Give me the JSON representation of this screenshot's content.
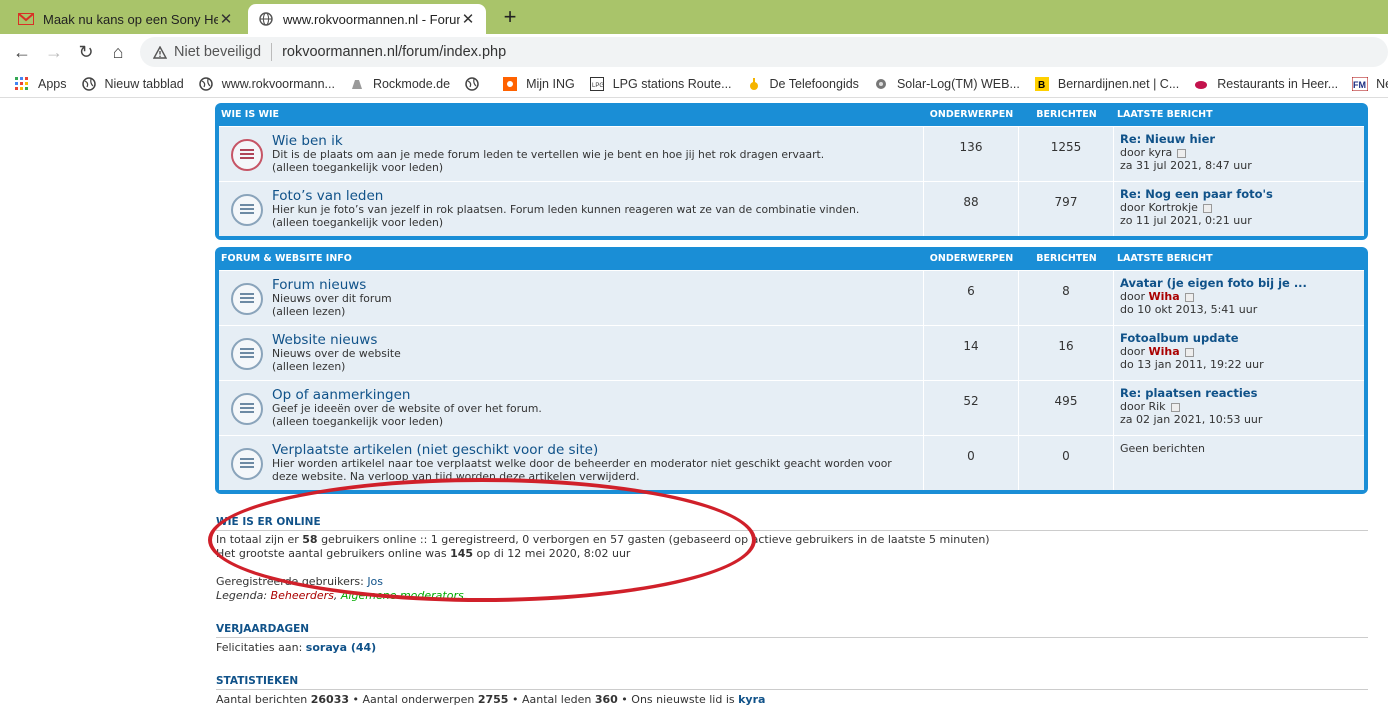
{
  "browser": {
    "tabs": [
      {
        "title": "Maak nu kans op een Sony Headp",
        "favicon": "gmail-icon",
        "active": false
      },
      {
        "title": "www.rokvoormannen.nl - Forum",
        "favicon": "globe-icon",
        "active": true
      }
    ],
    "security_label": "Niet beveiligd",
    "url": "rokvoormannen.nl/forum/index.php",
    "bookmarks": [
      {
        "label": "Apps",
        "icon": "apps-grid-icon"
      },
      {
        "label": "Nieuw tabblad",
        "icon": "globe-icon"
      },
      {
        "label": "www.rokvoormann...",
        "icon": "globe-icon"
      },
      {
        "label": "Rockmode.de",
        "icon": "rockmode-icon"
      },
      {
        "label": "",
        "icon": "globe-icon"
      },
      {
        "label": "Mijn ING",
        "icon": "ing-icon"
      },
      {
        "label": "LPG stations Route...",
        "icon": "lpg-icon"
      },
      {
        "label": "De Telefoongids",
        "icon": "telefoongids-icon"
      },
      {
        "label": "Solar-Log(TM) WEB...",
        "icon": "solarlog-icon"
      },
      {
        "label": "Bernardijnen.net | C...",
        "icon": "bernardijnen-icon"
      },
      {
        "label": "Restaurants in Heer...",
        "icon": "restaurants-icon"
      },
      {
        "label": "Nederlan",
        "icon": "fm-icon"
      }
    ]
  },
  "forum": {
    "col_topics": "ONDERWERPEN",
    "col_posts": "BERICHTEN",
    "col_last": "LAATSTE BERICHT",
    "categories": [
      {
        "name": "WIE IS WIE",
        "forums": [
          {
            "title": "Wie ben ik",
            "desc1": "Dit is de plaats om aan je mede forum leden te vertellen wie je bent en hoe jij het rok dragen ervaart.",
            "desc2": "(alleen toegankelijk voor leden)",
            "topics": "136",
            "posts": "1255",
            "last_title": "Re: Nieuw hier",
            "last_by": "door",
            "last_user": "kyra",
            "last_user_red": false,
            "last_date": "za 31 jul 2021, 8:47 uur",
            "unread": true
          },
          {
            "title": "Foto’s van leden",
            "desc1": "Hier kun je foto’s van jezelf in rok plaatsen. Forum leden kunnen reageren wat ze van de combinatie vinden.",
            "desc2": "(alleen toegankelijk voor leden)",
            "topics": "88",
            "posts": "797",
            "last_title": "Re: Nog een paar foto's",
            "last_by": "door",
            "last_user": "Kortrokje",
            "last_user_red": false,
            "last_date": "zo 11 jul 2021, 0:21 uur",
            "unread": false
          }
        ]
      },
      {
        "name": "FORUM & WEBSITE INFO",
        "forums": [
          {
            "title": "Forum nieuws",
            "desc1": "Nieuws over dit forum",
            "desc2": "(alleen lezen)",
            "topics": "6",
            "posts": "8",
            "last_title": "Avatar (je eigen foto bij je ...",
            "last_by": "door",
            "last_user": "Wiha",
            "last_user_red": true,
            "last_date": "do 10 okt 2013, 5:41 uur",
            "unread": false
          },
          {
            "title": "Website nieuws",
            "desc1": "Nieuws over de website",
            "desc2": "(alleen lezen)",
            "topics": "14",
            "posts": "16",
            "last_title": "Fotoalbum update",
            "last_by": "door",
            "last_user": "Wiha",
            "last_user_red": true,
            "last_date": "do 13 jan 2011, 19:22 uur",
            "unread": false
          },
          {
            "title": "Op of aanmerkingen",
            "desc1": "Geef je ideeën over de website of over het forum.",
            "desc2": "(alleen toegankelijk voor leden)",
            "topics": "52",
            "posts": "495",
            "last_title": "Re: plaatsen reacties",
            "last_by": "door",
            "last_user": "Rik",
            "last_user_red": false,
            "last_date": "za 02 jan 2021, 10:53 uur",
            "unread": false
          },
          {
            "title": "Verplaatste artikelen (niet geschikt voor de site)",
            "desc1": "Hier worden artikelel naar toe verplaatst welke door de beheerder en moderator niet geschikt geacht worden voor",
            "desc2": "deze website. Na verloop van tijd worden deze artikelen verwijderd.",
            "topics": "0",
            "posts": "0",
            "last_title": "",
            "last_by": "",
            "last_user": "",
            "last_user_red": false,
            "last_date": "",
            "no_posts": "Geen berichten",
            "unread": false
          }
        ]
      }
    ]
  },
  "online": {
    "heading": "WIE IS ER ONLINE",
    "line1_a": "In totaal zijn er",
    "total": "58",
    "line1_b": "gebruikers online :: 1 geregistreerd, 0 verborgen en 57 gasten (gebaseerd op actieve gebruikers in de laatste 5 minuten)",
    "line2_a": "Het grootste aantal gebruikers online was",
    "max": "145",
    "line2_b": "op di 12 mei 2020, 8:02 uur",
    "registered_label": "Geregistreerde gebruikers:",
    "registered_user": "Jos",
    "legend_label": "Legenda:",
    "legend_admins": "Beheerders",
    "legend_mods": "Algemene moderators"
  },
  "birthdays": {
    "heading": "VERJAARDAGEN",
    "label": "Felicitaties aan:",
    "user": "soraya (44)"
  },
  "stats": {
    "heading": "STATISTIEKEN",
    "posts_label": "Aantal berichten",
    "posts": "26033",
    "topics_label": "Aantal onderwerpen",
    "topics": "2755",
    "members_label": "Aantal leden",
    "members": "360",
    "newest_label": "Ons nieuwste lid is",
    "newest": "kyra"
  },
  "annotation_color": "#d0202a"
}
